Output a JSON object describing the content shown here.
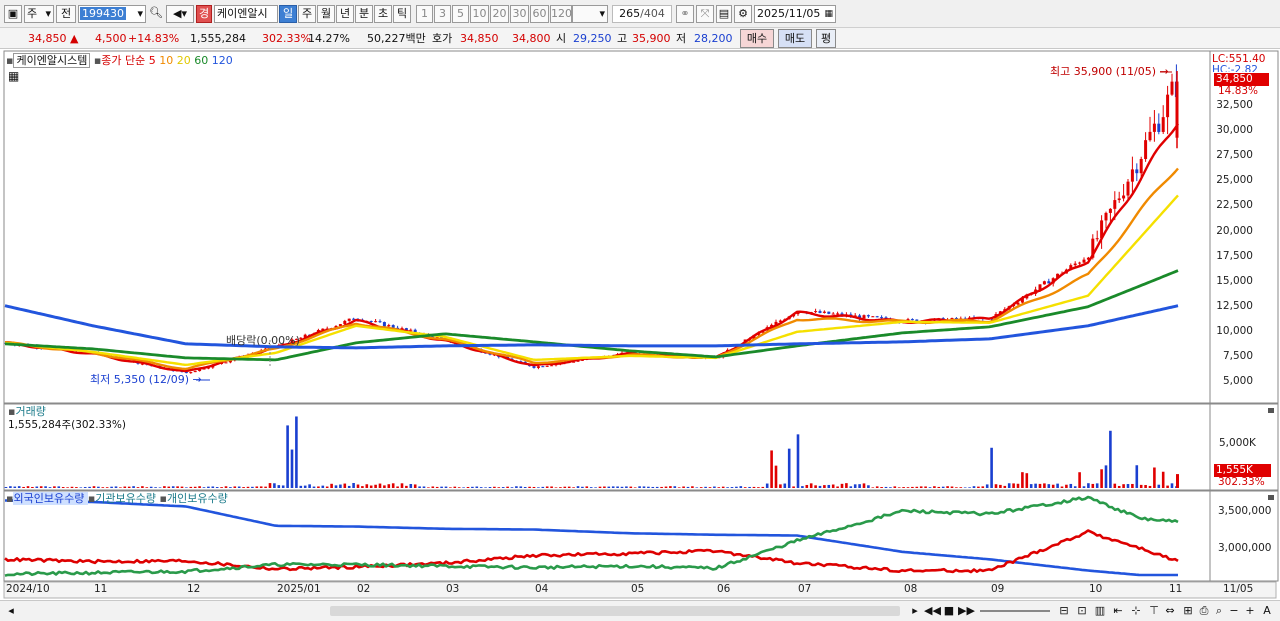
{
  "toolbar": {
    "period_unit": "주",
    "prev_label": "전",
    "code": "199430",
    "stock_name": "케이엔알시",
    "warn_badge": "경",
    "tabs": [
      "일",
      "주",
      "월",
      "년",
      "분",
      "초",
      "틱"
    ],
    "selected_tab": "일",
    "intervals": [
      "1",
      "3",
      "5",
      "10",
      "20",
      "30",
      "60",
      "120"
    ],
    "count": "265",
    "total": "/404",
    "date": "2025/11/05"
  },
  "quote": {
    "price": "34,850",
    "change": "4,500",
    "change_pct": "+14.83%",
    "volume": "1,555,284",
    "vol_ratio": "302.33%",
    "turnover": "14.27%",
    "amount": "50,227백만",
    "bid_label": "호가",
    "ask": "34,850",
    "bid": "34,800",
    "open_label": "시",
    "open": "29,250",
    "high_label": "고",
    "high": "35,900",
    "low_label": "저",
    "low": "28,200",
    "buy_label": "매수",
    "sell_label": "매도",
    "eval_label": "평"
  },
  "price_panel": {
    "stock_label": "케이엔알시스템",
    "ma_prefix": "종가 단순",
    "ma_periods": [
      "5",
      "10",
      "20",
      "60",
      "120"
    ],
    "ma_colors": [
      "#e00000",
      "#f08a00",
      "#f5e000",
      "#1a8a2a",
      "#2255dd"
    ],
    "lc_label": "LC:551.40",
    "hc_label": "HC:-2.82",
    "last_price_tag": "34,850",
    "last_pct_tag": "14.83%",
    "high_marker": "최고 35,900 (11/05)",
    "low_marker": "최저 5,350 (12/09)",
    "dividend_marker": "배당락(0.00%)"
  },
  "volume_panel": {
    "title": "거래량",
    "value_text": "1,555,284주(302.33%)",
    "tag_value": "1,555K",
    "tag_pct": "302.33%"
  },
  "holdings_panel": {
    "series_labels": [
      "외국인보유수량",
      "기관보유수량",
      "개인보유수량"
    ],
    "series_colors": [
      "#2255dd",
      "#dd0000",
      "#2a9a4a"
    ]
  },
  "chart_data": [
    {
      "type": "candlestick",
      "title": "케이엔알시스템",
      "x_ticks": [
        "2024/10",
        "11",
        "12",
        "2025/01",
        "02",
        "03",
        "04",
        "05",
        "06",
        "07",
        "08",
        "09",
        "10",
        "11",
        "11/05"
      ],
      "ylim": [
        4000,
        36500
      ],
      "y_ticks": [
        "5,000",
        "7,500",
        "10,000",
        "12,500",
        "15,000",
        "17,500",
        "20,000",
        "22,500",
        "25,000",
        "27,500",
        "30,000",
        "32,500"
      ],
      "series": [
        {
          "name": "종가",
          "x": [
            "2024/10",
            "11",
            "12",
            "2025/01",
            "02",
            "03",
            "04",
            "05",
            "06",
            "07",
            "08",
            "09",
            "10",
            "11/05"
          ],
          "values": [
            8800,
            7800,
            5800,
            8400,
            11300,
            9100,
            6400,
            7800,
            7300,
            12000,
            11000,
            11200,
            17500,
            34850
          ]
        },
        {
          "name": "5",
          "values": [
            8800,
            7700,
            5900,
            8300,
            11000,
            9000,
            6500,
            7700,
            7300,
            11800,
            10900,
            11200,
            17000,
            31000
          ]
        },
        {
          "name": "10",
          "values": [
            8800,
            7800,
            6200,
            8200,
            10800,
            9100,
            6800,
            7600,
            7300,
            11200,
            10900,
            11000,
            15500,
            26500
          ]
        },
        {
          "name": "20",
          "values": [
            8800,
            7900,
            6600,
            7800,
            10500,
            9400,
            7100,
            7500,
            7300,
            9900,
            10900,
            10800,
            13500,
            23500
          ]
        },
        {
          "name": "60",
          "values": [
            8700,
            8200,
            7300,
            7100,
            8800,
            9700,
            8900,
            8000,
            7400,
            8500,
            9800,
            10400,
            12400,
            16000
          ]
        },
        {
          "name": "120",
          "values": [
            12500,
            10500,
            8700,
            8400,
            8300,
            8500,
            8600,
            8500,
            8500,
            8700,
            8900,
            9200,
            10500,
            12500
          ]
        }
      ]
    },
    {
      "type": "bar",
      "title": "거래량",
      "ylabel": "",
      "y_ticks": [
        "5,000K"
      ],
      "ylim": [
        0,
        8500000
      ],
      "spike_labels": [
        "2025/01",
        "07",
        "09",
        "10",
        "11/05"
      ],
      "spike_values": [
        8000000,
        6000000,
        5200000,
        6400000,
        1555284
      ]
    },
    {
      "type": "line",
      "y_ticks": [
        "3,500,000",
        "3,000,000"
      ],
      "x_points": [
        "2024/10",
        "11",
        "12",
        "2025/01",
        "02",
        "03",
        "04",
        "05",
        "06",
        "07",
        "08",
        "09",
        "10",
        "11",
        "11/05"
      ],
      "series": [
        {
          "name": "외국인보유수량",
          "values": [
            3640000,
            3620000,
            3560000,
            3300000,
            3290000,
            3260000,
            3250000,
            3200000,
            3180000,
            3170000,
            2950000,
            2850000,
            2700000,
            2640000,
            2640000
          ]
        },
        {
          "name": "기관보유수량",
          "values": [
            2850000,
            2820000,
            2830000,
            2720000,
            2750000,
            2800000,
            2900000,
            2930000,
            2960000,
            2800000,
            2700000,
            2700000,
            3220000,
            3000000,
            2820000
          ]
        },
        {
          "name": "개인보유수량",
          "values": [
            2650000,
            2670000,
            2690000,
            2780000,
            2780000,
            2760000,
            2740000,
            2760000,
            2730000,
            3100000,
            3500000,
            3460000,
            3680000,
            3400000,
            3350000
          ]
        }
      ]
    }
  ]
}
